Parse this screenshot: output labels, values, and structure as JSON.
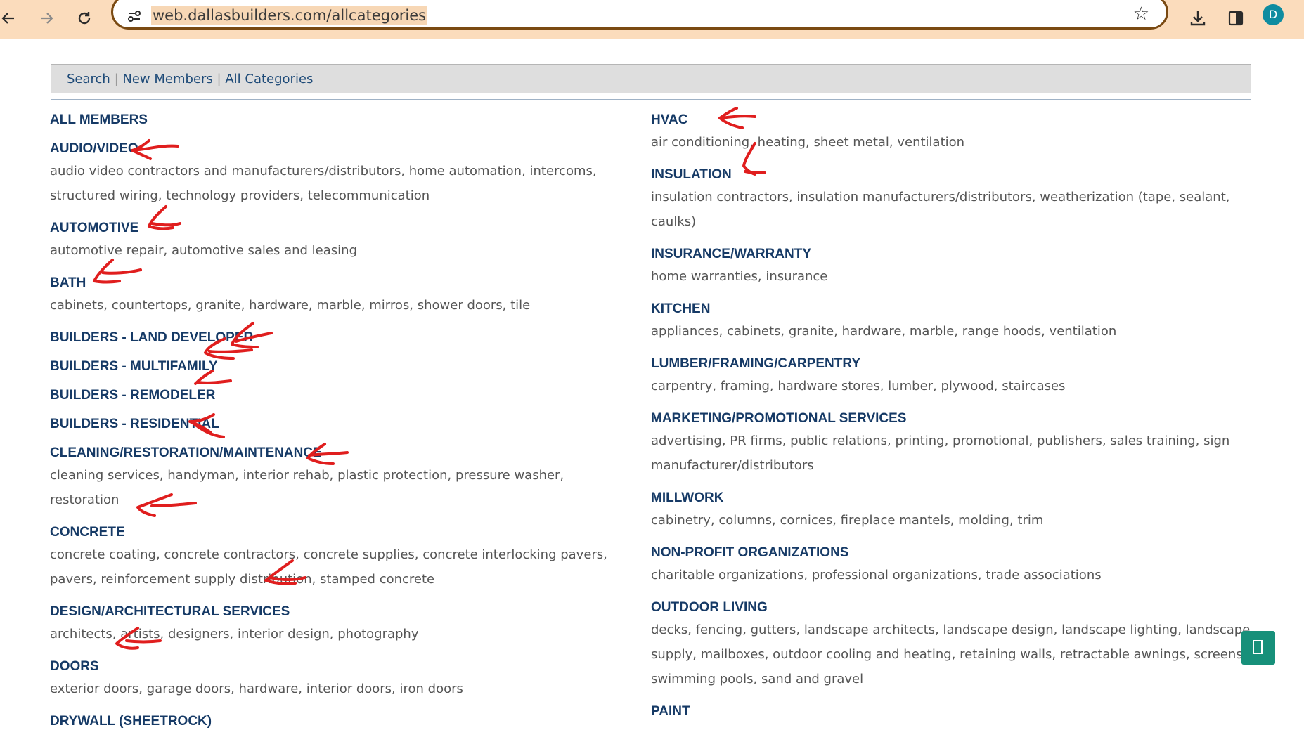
{
  "browser": {
    "url": "web.dallasbuilders.com/allcategories",
    "profile_initial": "D"
  },
  "nav": {
    "search": "Search",
    "separator": "|",
    "new_members": "New Members",
    "all_categories": "All Categories"
  },
  "left_column": [
    {
      "category": "ALL MEMBERS",
      "subs": ""
    },
    {
      "category": "AUDIO/VIDEO",
      "subs": "audio video contractors and manufacturers/distributors, home automation, intercoms, structured wiring, technology providers, telecommunication"
    },
    {
      "category": "AUTOMOTIVE",
      "subs": "automotive repair, automotive sales and leasing"
    },
    {
      "category": "BATH",
      "subs": "cabinets, countertops, granite, hardware, marble, mirros, shower doors, tile"
    },
    {
      "category": "BUILDERS - LAND DEVELOPER",
      "subs": ""
    },
    {
      "category": "BUILDERS - MULTIFAMILY",
      "subs": ""
    },
    {
      "category": "BUILDERS - REMODELER",
      "subs": ""
    },
    {
      "category": "BUILDERS - RESIDENTIAL",
      "subs": ""
    },
    {
      "category": "CLEANING/RESTORATION/MAINTENANCE",
      "subs": "cleaning services, handyman, interior rehab, plastic protection, pressure washer, restoration"
    },
    {
      "category": "CONCRETE",
      "subs": "concrete coating, concrete contractors, concrete supplies, concrete interlocking pavers, pavers, reinforcement supply distribution, stamped concrete"
    },
    {
      "category": "DESIGN/ARCHITECTURAL SERVICES",
      "subs": "architects, artists, designers, interior design, photography"
    },
    {
      "category": "DOORS",
      "subs": "exterior doors, garage doors, hardware, interior doors, iron doors"
    },
    {
      "category": "DRYWALL (SHEETROCK)",
      "subs": ""
    }
  ],
  "right_column": [
    {
      "category": "HVAC",
      "subs": "air conditioning, heating, sheet metal, ventilation"
    },
    {
      "category": "INSULATION",
      "subs": "insulation contractors, insulation manufacturers/distributors, weatherization (tape, sealant, caulks)"
    },
    {
      "category": "INSURANCE/WARRANTY",
      "subs": "home warranties, insurance"
    },
    {
      "category": "KITCHEN",
      "subs": "appliances, cabinets, granite, hardware, marble, range hoods, ventilation"
    },
    {
      "category": "LUMBER/FRAMING/CARPENTRY",
      "subs": "carpentry, framing, hardware stores, lumber, plywood, staircases"
    },
    {
      "category": "MARKETING/PROMOTIONAL SERVICES",
      "subs": "advertising, PR firms, public relations, printing, promotional, publishers, sales training, sign manufacturer/distributors"
    },
    {
      "category": "MILLWORK",
      "subs": "cabinetry, columns, cornices, fireplace mantels, molding, trim"
    },
    {
      "category": "NON-PROFIT ORGANIZATIONS",
      "subs": "charitable organizations, professional organizations, trade associations"
    },
    {
      "category": "OUTDOOR LIVING",
      "subs": "decks, fencing, gutters, landscape architects, landscape design, landscape lighting, landscape supply, mailboxes, outdoor cooling and heating, retaining walls, retractable awnings, screens, swimming pools, sand and gravel"
    },
    {
      "category": "PAINT",
      "subs": ""
    }
  ],
  "colors": {
    "chrome_bg": "#fbdcbc",
    "category_text": "#163a66",
    "sub_text": "#555555",
    "annotation_red": "#e01e1e",
    "floating_button": "#17907a"
  }
}
